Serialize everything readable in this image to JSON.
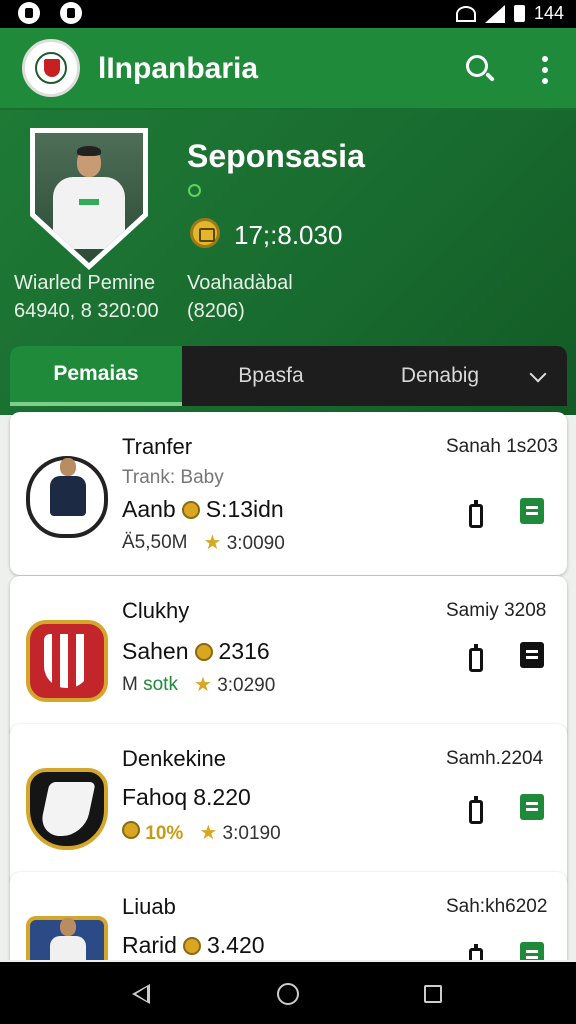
{
  "status_bar": {
    "time": "144"
  },
  "app_bar": {
    "title": "lInpanbaria"
  },
  "hero": {
    "club_name": "Seponsasia",
    "balance": "17;:8.030",
    "player_name": "Wiarled Pemine",
    "player_value": "64940, 8 320:00",
    "label": "Voahadàbal",
    "sub_label": "(8206)"
  },
  "tabs": [
    {
      "label": "Pemaias",
      "active": true
    },
    {
      "label": "Bpasfa",
      "active": false
    },
    {
      "label": "Denabig",
      "active": false
    }
  ],
  "cards": [
    {
      "title": "Tranfer",
      "date": "Sanah 1s203",
      "subtitle": "Trank: Baby",
      "line": "Aanb",
      "line2": "S:13idn",
      "meta_left": "Ä5,50M",
      "meta_right": "3:0090",
      "action_color": "#1f8a3a"
    },
    {
      "title": "Clukhy",
      "date": "Samiy 3208",
      "line": "Sahen",
      "line2": "2316",
      "meta_left_prefix": "M",
      "meta_left_green": "sotk",
      "meta_right": "3:0290",
      "action_color": "#111111"
    },
    {
      "title": "Denkekine",
      "date": "Samh.2204",
      "line": "Fahoq",
      "line2": "8.220",
      "meta_left": "10%",
      "meta_right": "3:0190",
      "action_color": "#1f8a3a"
    },
    {
      "title": "Liuab",
      "date": "Sah:kh6202",
      "line": "Rarid",
      "line2": "3.420",
      "action_color": "#1f8a3a"
    }
  ],
  "colors": {
    "primary": "#1f8a3a",
    "tab_bar": "#1d1d1d",
    "coin": "#d9a621"
  },
  "icons": [
    "search-icon",
    "more-vert-icon",
    "coin-icon",
    "star-icon",
    "phone-icon",
    "back-icon",
    "home-icon",
    "recents-icon"
  ]
}
